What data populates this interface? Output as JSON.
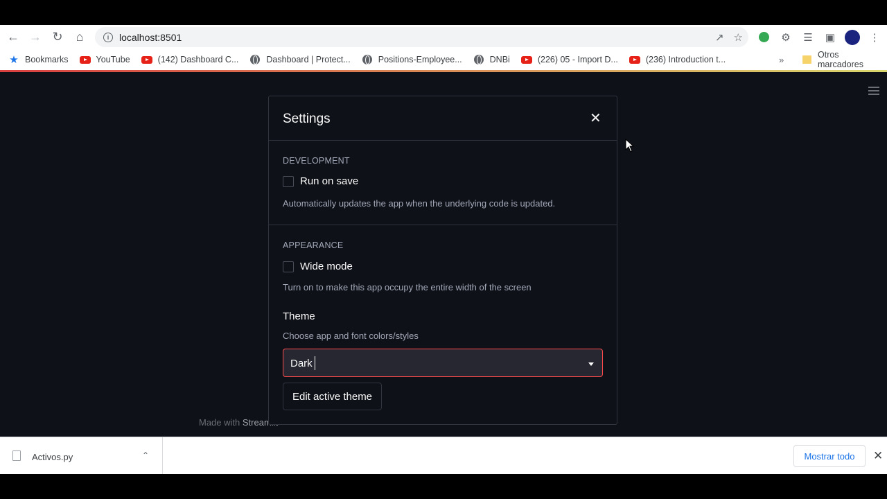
{
  "browser": {
    "url": "localhost:8501",
    "bookmarks": [
      {
        "label": "Bookmarks",
        "icon": "star-icon"
      },
      {
        "label": "YouTube",
        "icon": "youtube-icon"
      },
      {
        "label": "(142) Dashboard C...",
        "icon": "youtube-icon"
      },
      {
        "label": "Dashboard | Protect...",
        "icon": "globe-icon"
      },
      {
        "label": "Positions-Employee...",
        "icon": "globe-icon"
      },
      {
        "label": "DNBi",
        "icon": "globe-icon"
      },
      {
        "label": "(226) 05 - Import D...",
        "icon": "youtube-icon"
      },
      {
        "label": "(236) Introduction t...",
        "icon": "youtube-icon"
      }
    ],
    "more_label": "»",
    "other_bookmarks": "Otros marcadores"
  },
  "settings": {
    "title": "Settings",
    "close_label": "✕",
    "development": {
      "label": "DEVELOPMENT",
      "run_on_save": "Run on save",
      "run_on_save_checked": false,
      "run_on_save_desc": "Automatically updates the app when the underlying code is updated."
    },
    "appearance": {
      "label": "APPEARANCE",
      "wide_mode": "Wide mode",
      "wide_mode_checked": false,
      "wide_mode_desc": "Turn on to make this app occupy the entire width of the screen"
    },
    "theme": {
      "title": "Theme",
      "desc": "Choose app and font colors/styles",
      "selected": "Dark",
      "edit_button": "Edit active theme"
    }
  },
  "footer": {
    "made_with": "Made with",
    "brand": "Streamlit"
  },
  "download_shelf": {
    "file_name": "Activos.py",
    "show_all": "Mostrar todo",
    "close_label": "✕"
  },
  "colors": {
    "app_bg": "#0e1117",
    "accent": "#ff4b4b",
    "link": "#1a73e8"
  }
}
